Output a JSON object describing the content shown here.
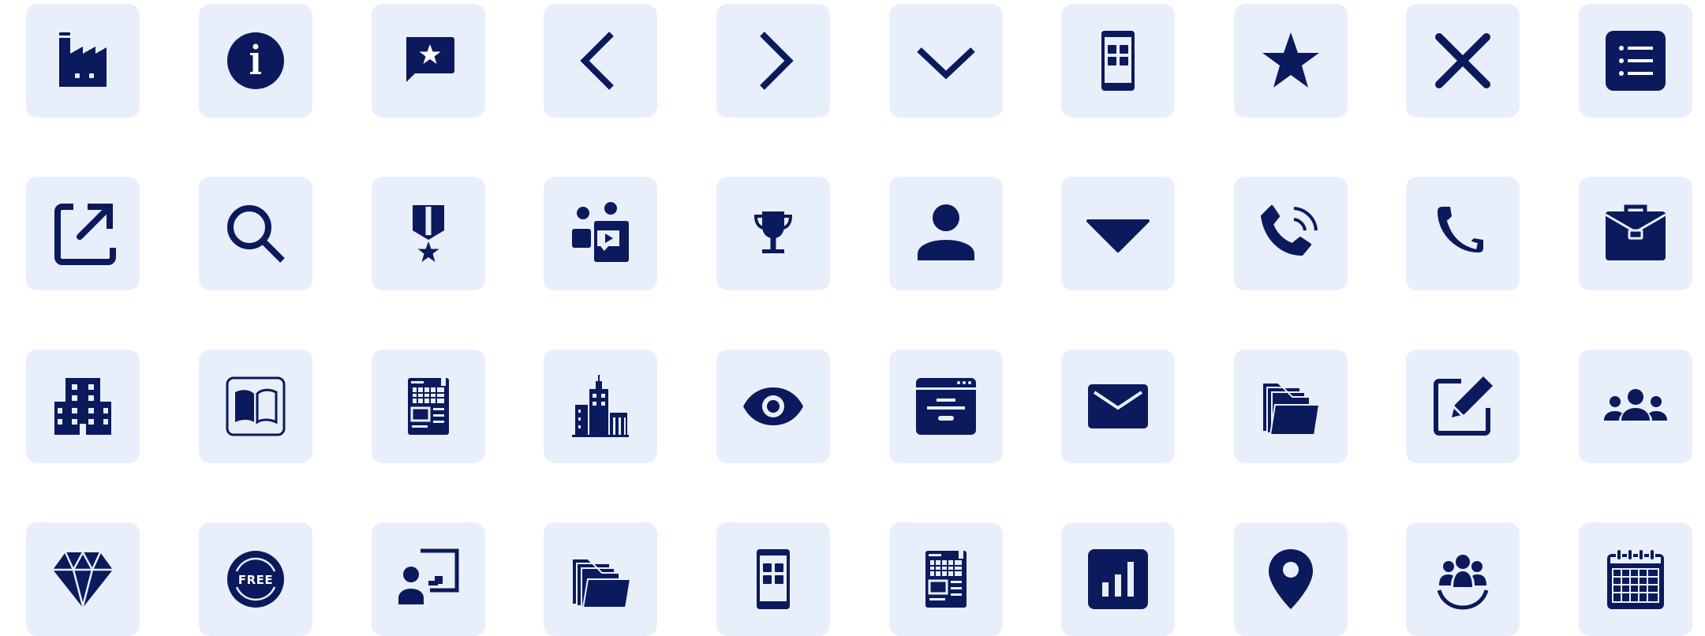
{
  "theme": {
    "tile_bg": "#e8effb",
    "icon_color": "#0b1a5c",
    "page_bg": "#ffffff"
  },
  "icons": [
    [
      "factory-icon",
      "info-icon",
      "chat-star-icon",
      "chevron-left-icon",
      "chevron-right-icon",
      "chevron-down-icon",
      "tablet-grid-icon",
      "star-icon",
      "close-icon",
      "list-icon"
    ],
    [
      "external-link-icon",
      "search-icon",
      "medal-icon",
      "video-meeting-icon",
      "trophy-icon",
      "user-icon",
      "caret-down-icon",
      "phone-ringing-icon",
      "phone-icon",
      "briefcase-icon"
    ],
    [
      "office-building-icon",
      "book-icon",
      "newspaper-icon",
      "city-icon",
      "eye-icon",
      "browser-window-icon",
      "mail-icon",
      "folders-icon",
      "edit-icon",
      "team-icon"
    ],
    [
      "diamond-icon",
      "free-badge-icon",
      "presenter-icon",
      "folders-open-icon",
      "tablet-grid-icon",
      "newspaper-icon",
      "bar-chart-icon",
      "location-pin-icon",
      "group-icon",
      "calendar-icon"
    ]
  ],
  "free_badge": {
    "label": "FREE"
  }
}
